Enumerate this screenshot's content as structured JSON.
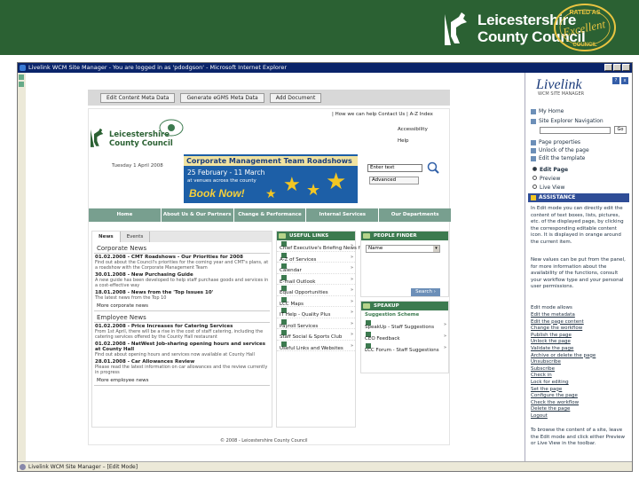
{
  "banner": {
    "org_line1": "Leicestershire",
    "org_line2": "County Council",
    "seal_top": "RATED AS",
    "seal_main": "Excellent",
    "seal_bottom": "COUNCIL",
    "bg_color": "#2b6133"
  },
  "browser": {
    "title": "Livelink WCM Site Manager - You are logged in as 'pdodgson' - Microsoft Internet Explorer",
    "status": "Livelink WCM Site Manager – [Edit Mode]"
  },
  "metadata_bar": {
    "buttons": [
      "Edit Content Meta Data",
      "Generate eGMS Meta Data",
      "Add Document"
    ]
  },
  "site": {
    "logo_line1": "Leicestershire",
    "logo_line2": "County Council",
    "date": "Tuesday 1 April 2008",
    "top_links": "| How we can help  Contact Us  | A-Z Index",
    "accessibility": "Accessibility",
    "help": "Help",
    "search_placeholder": "Enter text",
    "advanced_search": "Advanced",
    "roadshow": {
      "title": "Corporate Management Team Roadshows",
      "dates": "25 February - 11 March",
      "subtitle": "at venues across the county",
      "cta": "Book Now!"
    },
    "nav": [
      "Home",
      "About Us & Our Partners",
      "Change & Performance",
      "Internal Services",
      "Our Departments"
    ],
    "news": {
      "tabs": [
        "News",
        "Events"
      ],
      "corporate_heading": "Corporate News",
      "corporate_items": [
        {
          "title": "01.02.2008 - CMT Roadshows - Our Priorities for 2008",
          "desc": "Find out about the Council's priorities for the coming year and CMT's plans, at a roadshow with the Corporate Management Team"
        },
        {
          "title": "30.01.2008 - New Purchasing Guide",
          "desc": "A new guide has been developed to help staff purchase goods and services in a cost-effective way"
        },
        {
          "title": "18.01.2008 - News from the 'Top Issues 10'",
          "desc": "The latest news from the Top 10"
        }
      ],
      "corporate_more": "More corporate news",
      "employee_heading": "Employee News",
      "employee_items": [
        {
          "title": "01.02.2008 - Price Increases for Catering Services",
          "desc": "From 1st April, there will be a rise in the cost of staff catering, including the catering services offered by the County Hall restaurant"
        },
        {
          "title": "01.02.2008 - NatWest Job-sharing opening hours and services at County Hall",
          "desc": "Find out about opening hours and services now available at County Hall"
        },
        {
          "title": "28.01.2008 - Car Allowances Review",
          "desc": "Please read the latest information on car allowances and the review currently in progress"
        }
      ],
      "employee_more": "More employee news"
    },
    "useful_links": {
      "heading": "USEFUL LINKS",
      "items": [
        "Chief Executive's Briefing News from the top",
        "A-Z of Services",
        "Calendar",
        "E-mail Outlook",
        "Equal Opportunities",
        "LCC Maps",
        "IT Help - Quality Plus",
        "Payroll Services",
        "Staff Social & Sports Club",
        "Useful Links and Websites"
      ]
    },
    "people_finder": {
      "heading": "PEOPLE FINDER",
      "select_value": "Name",
      "button": "Search ›"
    },
    "speakup": {
      "heading": "SPEAKUP",
      "subheading": "Suggestion Scheme",
      "items": [
        "SpeakUp - Staff Suggestions",
        "CEO Feedback",
        "LCC Forum - Staff Suggestions"
      ]
    },
    "footer": "© 2008 - Leicestershire County Council"
  },
  "livelink_panel": {
    "logo": "Livelink",
    "subtitle": "WCM SITE MANAGER",
    "icons": [
      "?",
      "x"
    ],
    "my_home": "My Home",
    "site_explorer": "Site Explorer Navigation",
    "go_label": "Go",
    "actions": [
      "Page properties",
      "Unlock of the page",
      "Edit the template"
    ],
    "modes": [
      "Edit Page",
      "Preview",
      "Live View"
    ],
    "assistance_heading": "ASSISTANCE",
    "para1": "In Edit mode you can directly edit the content of text boxes, lists, pictures, etc. of the displayed page, by clicking the corresponding editable content icon. It is displayed in orange around the current item.",
    "para2": "New values can be put from the panel, for more information about the availability of the functions, consult your workflow type and your personal user permissions.",
    "para3": "Edit mode allows",
    "links": [
      "Edit the metadata",
      "Edit the page content",
      "Change the workflow",
      "Publish the page",
      "Unlock the page",
      "Validate the page",
      "Archive or delete the page",
      "Unsubscribe",
      "Subscribe",
      "Check in",
      "Lock for editing",
      "Set the page",
      "Configure the page",
      "Check the workflow",
      "Delete the page",
      "Logout"
    ],
    "para4": "To browse the content of a site, leave the Edit mode and click either Preview or Live View in the toolbar."
  }
}
